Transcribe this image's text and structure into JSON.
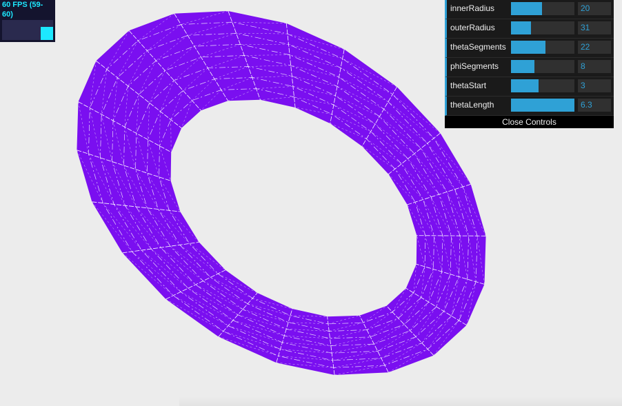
{
  "stats": {
    "fps_text": "60 FPS (59-60)",
    "color": "#1de8ff"
  },
  "mesh": {
    "fill_color": "#7a0ff0",
    "wire_color": "#ffffff"
  },
  "controls": {
    "rows": [
      {
        "label": "innerRadius",
        "value": "20",
        "fraction": 0.49
      },
      {
        "label": "outerRadius",
        "value": "31",
        "fraction": 0.32
      },
      {
        "label": "thetaSegments",
        "value": "22",
        "fraction": 0.54
      },
      {
        "label": "phiSegments",
        "value": "8",
        "fraction": 0.37
      },
      {
        "label": "thetaStart",
        "value": "3",
        "fraction": 0.43
      },
      {
        "label": "thetaLength",
        "value": "6.3",
        "fraction": 1.0
      }
    ],
    "close_label": "Close Controls",
    "accent_color": "#2fa1d6"
  }
}
